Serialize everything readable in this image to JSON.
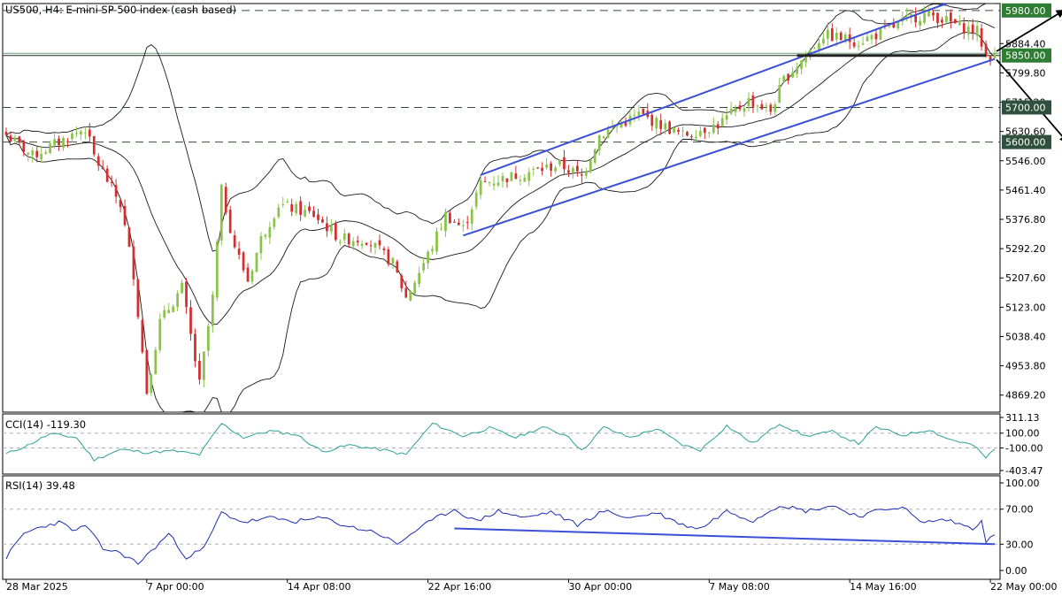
{
  "title": "US500, H4:  E-mini SP 500 index (cash based)",
  "colors": {
    "bull": "#8bc34a",
    "bear": "#d32f2f",
    "band": "#1a1a1a",
    "trend": "#3b4fd8",
    "level": "#3a4a3a",
    "support": "#1f2a1f",
    "cci": "#2aa198",
    "rsi": "#1a2bb5",
    "label_bg": "#2f4f3f",
    "label_bg_main": "#2e7d32",
    "grid": "#b0b0b0"
  },
  "price_axis": {
    "ticks": [
      "5884.40",
      "5799.80",
      "5715.20",
      "5630.60",
      "5546.00",
      "5461.40",
      "5376.80",
      "5292.20",
      "5207.60",
      "5123.00",
      "5038.40",
      "4953.80",
      "4869.20"
    ],
    "tick_values": [
      5884.4,
      5799.8,
      5715.2,
      5630.6,
      5546.0,
      5461.4,
      5376.8,
      5292.2,
      5207.6,
      5123.0,
      5038.4,
      4953.8,
      4869.2
    ],
    "range": [
      4820,
      6000
    ]
  },
  "levels": [
    {
      "value": 5980,
      "label": "5980.00",
      "style": "dashed",
      "emphasis": true
    },
    {
      "value": 5850,
      "label": "5850.00",
      "style": "solid",
      "emphasis": true
    },
    {
      "value": 5700,
      "label": "5700.00",
      "style": "dashed",
      "emphasis": false
    },
    {
      "value": 5600,
      "label": "5600.00",
      "style": "dashed",
      "emphasis": false
    }
  ],
  "time_axis": {
    "labels": [
      "28 Mar 2025",
      "7 Apr 00:00",
      "14 Apr 08:00",
      "22 Apr 16:00",
      "30 Apr 00:00",
      "7 May 08:00",
      "14 May 16:00",
      "22 May 00:00"
    ],
    "bar_index": [
      0,
      32,
      64,
      96,
      128,
      160,
      192,
      224
    ]
  },
  "chart_data": [
    {
      "type": "candlestick",
      "title": "US500, H4:  E-mini SP 500 index (cash based)",
      "timeframe": "H4",
      "bars": 226,
      "indicator": "Bollinger Bands",
      "anchors": [
        {
          "bar": 0,
          "price": 5620
        },
        {
          "bar": 6,
          "price": 5560
        },
        {
          "bar": 12,
          "price": 5600
        },
        {
          "bar": 18,
          "price": 5640
        },
        {
          "bar": 20,
          "price": 5560
        },
        {
          "bar": 26,
          "price": 5420
        },
        {
          "bar": 29,
          "price": 5220
        },
        {
          "bar": 32,
          "price": 4880
        },
        {
          "bar": 35,
          "price": 5080
        },
        {
          "bar": 40,
          "price": 5180
        },
        {
          "bar": 44,
          "price": 4900
        },
        {
          "bar": 47,
          "price": 5150
        },
        {
          "bar": 49,
          "price": 5460
        },
        {
          "bar": 52,
          "price": 5300
        },
        {
          "bar": 55,
          "price": 5200
        },
        {
          "bar": 58,
          "price": 5320
        },
        {
          "bar": 62,
          "price": 5420
        },
        {
          "bar": 70,
          "price": 5390
        },
        {
          "bar": 76,
          "price": 5320
        },
        {
          "bar": 82,
          "price": 5320
        },
        {
          "bar": 88,
          "price": 5250
        },
        {
          "bar": 91,
          "price": 5150
        },
        {
          "bar": 97,
          "price": 5300
        },
        {
          "bar": 100,
          "price": 5390
        },
        {
          "bar": 104,
          "price": 5350
        },
        {
          "bar": 108,
          "price": 5480
        },
        {
          "bar": 118,
          "price": 5510
        },
        {
          "bar": 126,
          "price": 5535
        },
        {
          "bar": 131,
          "price": 5500
        },
        {
          "bar": 135,
          "price": 5620
        },
        {
          "bar": 144,
          "price": 5680
        },
        {
          "bar": 154,
          "price": 5620
        },
        {
          "bar": 162,
          "price": 5650
        },
        {
          "bar": 169,
          "price": 5720
        },
        {
          "bar": 174,
          "price": 5690
        },
        {
          "bar": 177,
          "price": 5780
        },
        {
          "bar": 182,
          "price": 5850
        },
        {
          "bar": 186,
          "price": 5910
        },
        {
          "bar": 194,
          "price": 5890
        },
        {
          "bar": 200,
          "price": 5920
        },
        {
          "bar": 206,
          "price": 5960
        },
        {
          "bar": 210,
          "price": 5970
        },
        {
          "bar": 214,
          "price": 5950
        },
        {
          "bar": 218,
          "price": 5930
        },
        {
          "bar": 221,
          "price": 5920
        },
        {
          "bar": 223,
          "price": 5850
        },
        {
          "bar": 225,
          "price": 5845
        }
      ]
    },
    {
      "type": "line",
      "title": "CCI(14) -119.30",
      "series": [
        {
          "name": "CCI(14)",
          "last": -119.3
        }
      ],
      "ticks": [
        "311.13",
        "100.00",
        "-100.00",
        "-403.47"
      ],
      "tick_values": [
        311.13,
        100,
        -100,
        -403.47
      ],
      "ylim": [
        -403.47,
        311.13
      ],
      "levels": [
        100,
        -100
      ],
      "anchors": [
        {
          "bar": 0,
          "v": -180
        },
        {
          "bar": 5,
          "v": -60
        },
        {
          "bar": 10,
          "v": 90
        },
        {
          "bar": 16,
          "v": 40
        },
        {
          "bar": 20,
          "v": -260
        },
        {
          "bar": 26,
          "v": -120
        },
        {
          "bar": 32,
          "v": -160
        },
        {
          "bar": 38,
          "v": -140
        },
        {
          "bar": 44,
          "v": -190
        },
        {
          "bar": 49,
          "v": 230
        },
        {
          "bar": 54,
          "v": 40
        },
        {
          "bar": 60,
          "v": 130
        },
        {
          "bar": 66,
          "v": 80
        },
        {
          "bar": 72,
          "v": -150
        },
        {
          "bar": 78,
          "v": -60
        },
        {
          "bar": 86,
          "v": -130
        },
        {
          "bar": 91,
          "v": -190
        },
        {
          "bar": 97,
          "v": 230
        },
        {
          "bar": 104,
          "v": 60
        },
        {
          "bar": 110,
          "v": 170
        },
        {
          "bar": 116,
          "v": 40
        },
        {
          "bar": 122,
          "v": 180
        },
        {
          "bar": 128,
          "v": 60
        },
        {
          "bar": 131,
          "v": -140
        },
        {
          "bar": 136,
          "v": 180
        },
        {
          "bar": 142,
          "v": 40
        },
        {
          "bar": 148,
          "v": 160
        },
        {
          "bar": 154,
          "v": -60
        },
        {
          "bar": 158,
          "v": -130
        },
        {
          "bar": 164,
          "v": 200
        },
        {
          "bar": 170,
          "v": -40
        },
        {
          "bar": 176,
          "v": 230
        },
        {
          "bar": 182,
          "v": 60
        },
        {
          "bar": 188,
          "v": 120
        },
        {
          "bar": 194,
          "v": -40
        },
        {
          "bar": 198,
          "v": 180
        },
        {
          "bar": 204,
          "v": 70
        },
        {
          "bar": 210,
          "v": 150
        },
        {
          "bar": 214,
          "v": 30
        },
        {
          "bar": 220,
          "v": -60
        },
        {
          "bar": 223,
          "v": -230
        },
        {
          "bar": 225,
          "v": -119.3
        }
      ]
    },
    {
      "type": "line",
      "title": "RSI(14) 39.48",
      "series": [
        {
          "name": "RSI(14)",
          "last": 39.48
        }
      ],
      "ticks": [
        "100.00",
        "70.00",
        "30.00",
        "0.00"
      ],
      "tick_values": [
        100,
        70,
        30,
        0
      ],
      "ylim": [
        0,
        100
      ],
      "levels": [
        70,
        30
      ],
      "divergence_line": [
        {
          "bar": 102,
          "v": 48
        },
        {
          "bar": 225,
          "v": 30
        }
      ],
      "anchors": [
        {
          "bar": 0,
          "v": 15
        },
        {
          "bar": 4,
          "v": 42
        },
        {
          "bar": 8,
          "v": 50
        },
        {
          "bar": 12,
          "v": 55
        },
        {
          "bar": 16,
          "v": 45
        },
        {
          "bar": 18,
          "v": 52
        },
        {
          "bar": 22,
          "v": 25
        },
        {
          "bar": 26,
          "v": 20
        },
        {
          "bar": 30,
          "v": 8
        },
        {
          "bar": 33,
          "v": 22
        },
        {
          "bar": 37,
          "v": 42
        },
        {
          "bar": 41,
          "v": 15
        },
        {
          "bar": 45,
          "v": 25
        },
        {
          "bar": 49,
          "v": 66
        },
        {
          "bar": 54,
          "v": 55
        },
        {
          "bar": 60,
          "v": 60
        },
        {
          "bar": 66,
          "v": 56
        },
        {
          "bar": 72,
          "v": 60
        },
        {
          "bar": 78,
          "v": 50
        },
        {
          "bar": 84,
          "v": 44
        },
        {
          "bar": 89,
          "v": 30
        },
        {
          "bar": 93,
          "v": 45
        },
        {
          "bar": 98,
          "v": 60
        },
        {
          "bar": 102,
          "v": 70
        },
        {
          "bar": 107,
          "v": 56
        },
        {
          "bar": 112,
          "v": 68
        },
        {
          "bar": 118,
          "v": 60
        },
        {
          "bar": 124,
          "v": 67
        },
        {
          "bar": 130,
          "v": 52
        },
        {
          "bar": 136,
          "v": 68
        },
        {
          "bar": 142,
          "v": 60
        },
        {
          "bar": 148,
          "v": 66
        },
        {
          "bar": 154,
          "v": 52
        },
        {
          "bar": 158,
          "v": 48
        },
        {
          "bar": 164,
          "v": 68
        },
        {
          "bar": 170,
          "v": 57
        },
        {
          "bar": 176,
          "v": 75
        },
        {
          "bar": 182,
          "v": 68
        },
        {
          "bar": 188,
          "v": 74
        },
        {
          "bar": 194,
          "v": 62
        },
        {
          "bar": 200,
          "v": 70
        },
        {
          "bar": 204,
          "v": 73
        },
        {
          "bar": 208,
          "v": 55
        },
        {
          "bar": 214,
          "v": 58
        },
        {
          "bar": 220,
          "v": 48
        },
        {
          "bar": 222,
          "v": 58
        },
        {
          "bar": 223,
          "v": 34
        },
        {
          "bar": 225,
          "v": 39.48
        }
      ]
    }
  ],
  "cci_label": "CCI(14) -119.30",
  "rsi_label": "RSI(14) 39.48"
}
